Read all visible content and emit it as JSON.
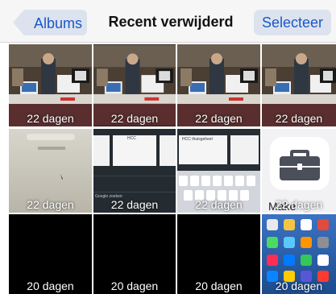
{
  "navbar": {
    "back_label": "Albums",
    "title": "Recent verwijderd",
    "select_label": "Selecteer"
  },
  "grid": {
    "rows": [
      [
        {
          "kind": "exhibition-photo",
          "caption": "22 dagen"
        },
        {
          "kind": "exhibition-photo",
          "caption": "22 dagen"
        },
        {
          "kind": "exhibition-photo",
          "caption": "22 dagen"
        },
        {
          "kind": "exhibition-photo",
          "caption": "22 dagen"
        }
      ],
      [
        {
          "kind": "blurry-screen-photo",
          "caption": "22 dagen"
        },
        {
          "kind": "search-screenshot",
          "caption": "22 dagen"
        },
        {
          "kind": "keyboard-screenshot",
          "caption": "22 dagen"
        },
        {
          "kind": "toolbox-app-icon",
          "caption": "22 dagen",
          "background_label": "Make"
        }
      ],
      [
        {
          "kind": "black",
          "caption": "20 dagen"
        },
        {
          "kind": "black",
          "caption": "20 dagen"
        },
        {
          "kind": "black",
          "caption": "20 dagen"
        },
        {
          "kind": "home-screen-screenshot",
          "caption": "20 dagen"
        }
      ]
    ]
  },
  "screenshot_texts": {
    "search_screen_top": "HCC",
    "search_screen_suggest": "Google zoeken",
    "keyboard_field": "HCC thuisgeheel",
    "keyboard_row1": [
      "q",
      "w",
      "e",
      "r",
      "t",
      "y",
      "u"
    ],
    "keyboard_row2": [
      "a",
      "s",
      "d",
      "f",
      "g",
      "h",
      "j"
    ]
  },
  "colors": {
    "accent": "#1a57c8",
    "navbar_bg": "#f6f6f7",
    "select_bg": "#dde3ee",
    "back_bg": "#dde3ee",
    "toolbox_bg": "#f2f2f4",
    "toolbox_icon": "#4a4f5a"
  }
}
